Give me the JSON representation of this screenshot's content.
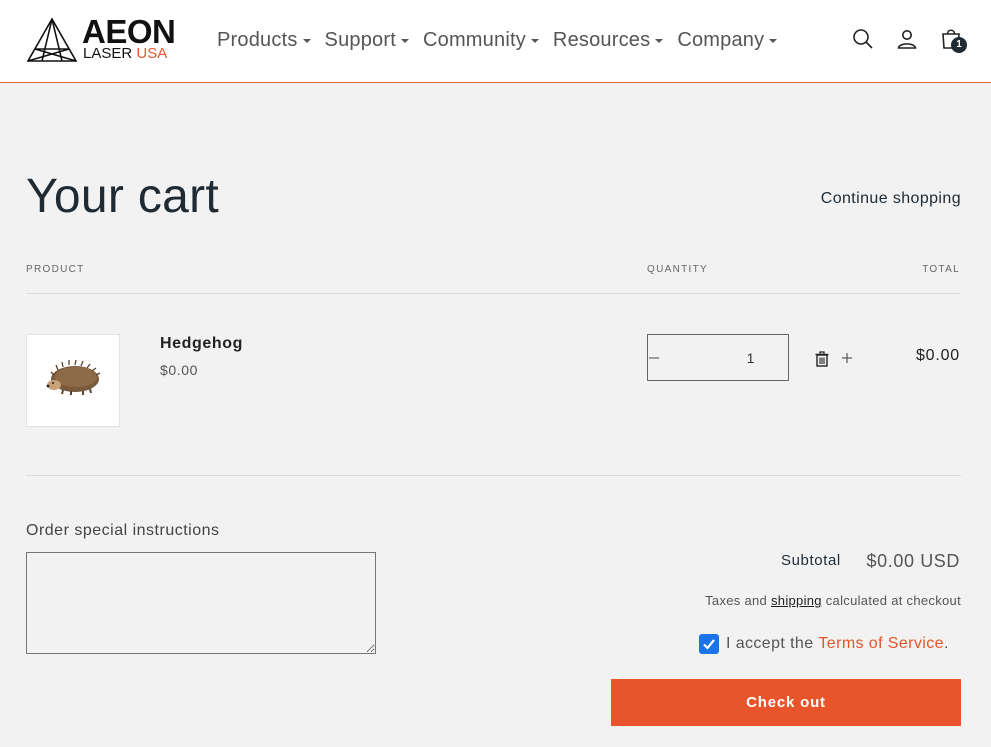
{
  "brand": {
    "word": "AEON",
    "sub_plain": "LASER",
    "sub_accent": "USA",
    "accent_color": "#e4552a"
  },
  "nav": {
    "items": [
      {
        "label": "Products"
      },
      {
        "label": "Support"
      },
      {
        "label": "Community"
      },
      {
        "label": "Resources"
      },
      {
        "label": "Company"
      }
    ]
  },
  "header_icons": {
    "search": "search-icon",
    "account": "user-icon",
    "cart": "cart-icon",
    "cart_count": "1"
  },
  "cart": {
    "title": "Your cart",
    "continue_label": "Continue shopping",
    "columns": {
      "product": "PRODUCT",
      "quantity": "QUANTITY",
      "total": "TOTAL"
    },
    "items": [
      {
        "name": "Hedgehog",
        "price": "$0.00",
        "quantity": "1",
        "total": "$0.00"
      }
    ],
    "instructions_label": "Order special instructions",
    "subtotal_label": "Subtotal",
    "subtotal_value": "$0.00 USD",
    "tax_before": "Taxes and",
    "tax_link": "shipping",
    "tax_after": "calculated at checkout",
    "terms_before": "I accept the",
    "terms_link": "Terms of Service",
    "terms_after": ".",
    "checkout_label": "Check out"
  }
}
